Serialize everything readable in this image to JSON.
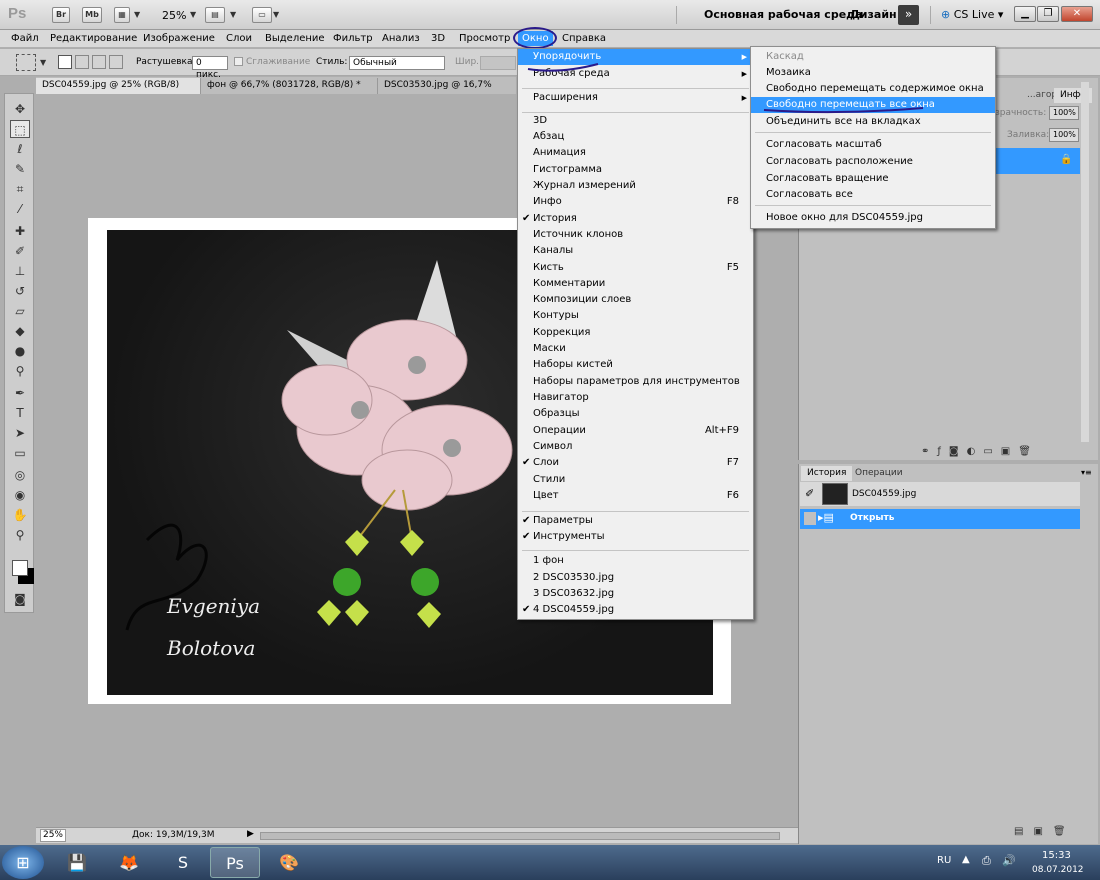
{
  "app": {
    "logo": "Ps",
    "zoom": "25%",
    "workspace_main": "Основная рабочая среда",
    "workspace_design": "Дизайн",
    "more": "»",
    "cslive": "CS Live",
    "buttons": [
      "Br",
      "Mb"
    ]
  },
  "menubar": [
    "Файл",
    "Редактирование",
    "Изображение",
    "Слои",
    "Выделение",
    "Фильтр",
    "Анализ",
    "3D",
    "Просмотр",
    "Окно",
    "Справка"
  ],
  "options": {
    "feather_label": "Растушевка:",
    "feather_value": "0 пикс.",
    "antialias": "Сглаживание",
    "style_label": "Стиль:",
    "style_value": "Обычный",
    "width_label": "Шир.:"
  },
  "tabs": [
    "DSC04559.jpg @ 25% (RGB/8)",
    "фон @ 66,7% (8031728, RGB/8) *",
    "DSC03530.jpg @ 16,7% (RGB/8"
  ],
  "status": {
    "zoom": "25%",
    "doc": "Док: 19,3M/19,3M"
  },
  "watermark": [
    "Evgeniya",
    "Bolotova"
  ],
  "window_menu": [
    {
      "label": "Упорядочить",
      "arrow": true,
      "highlight": true
    },
    {
      "label": "Рабочая среда",
      "arrow": true
    },
    {
      "sep": true
    },
    {
      "label": "Расширения",
      "arrow": true
    },
    {
      "sep": true
    },
    {
      "label": "3D"
    },
    {
      "label": "Абзац"
    },
    {
      "label": "Анимация"
    },
    {
      "label": "Гистограмма"
    },
    {
      "label": "Журнал измерений"
    },
    {
      "label": "Инфо",
      "shortcut": "F8"
    },
    {
      "label": "История",
      "check": true
    },
    {
      "label": "Источник клонов"
    },
    {
      "label": "Каналы"
    },
    {
      "label": "Кисть",
      "shortcut": "F5"
    },
    {
      "label": "Комментарии"
    },
    {
      "label": "Композиции слоев"
    },
    {
      "label": "Контуры"
    },
    {
      "label": "Коррекция"
    },
    {
      "label": "Маски"
    },
    {
      "label": "Наборы кистей"
    },
    {
      "label": "Наборы параметров для инструментов"
    },
    {
      "label": "Навигатор"
    },
    {
      "label": "Образцы"
    },
    {
      "label": "Операции",
      "shortcut": "Alt+F9"
    },
    {
      "label": "Символ"
    },
    {
      "label": "Слои",
      "shortcut": "F7",
      "check": true
    },
    {
      "label": "Стили"
    },
    {
      "label": "Цвет",
      "shortcut": "F6"
    },
    {
      "sep": true
    },
    {
      "label": "Параметры",
      "check": true
    },
    {
      "label": "Инструменты",
      "check": true
    },
    {
      "sep": true
    },
    {
      "label": "1 фон"
    },
    {
      "label": "2 DSC03530.jpg"
    },
    {
      "label": "3 DSC03632.jpg"
    },
    {
      "label": "4 DSC04559.jpg",
      "check": true
    }
  ],
  "arrange_menu": [
    {
      "label": "Каскад",
      "disabled": true
    },
    {
      "label": "Мозаика"
    },
    {
      "label": "Свободно перемещать содержимое окна"
    },
    {
      "label": "Свободно перемещать все окна",
      "highlight": true
    },
    {
      "label": "Объединить все на вкладках"
    },
    {
      "sep": true
    },
    {
      "label": "Согласовать масштаб"
    },
    {
      "label": "Согласовать расположение"
    },
    {
      "label": "Согласовать вращение"
    },
    {
      "label": "Согласовать все"
    },
    {
      "sep": true
    },
    {
      "label": "Новое окно для DSC04559.jpg"
    }
  ],
  "layers_panel": {
    "tab_history": "...агор",
    "tab_info": "Инфо",
    "opacity_label": "зрачность:",
    "opacity": "100%",
    "fill_label": "Заливка:",
    "fill": "100%"
  },
  "history_panel": {
    "tabs": [
      "История",
      "Операции"
    ],
    "snapshot": "DSC04559.jpg",
    "step": "Открыть"
  },
  "tray": {
    "lang": "RU",
    "time": "15:33",
    "date": "08.07.2012"
  },
  "colors": {
    "highlight": "#3399ff",
    "annotation": "#2a1a8a"
  }
}
